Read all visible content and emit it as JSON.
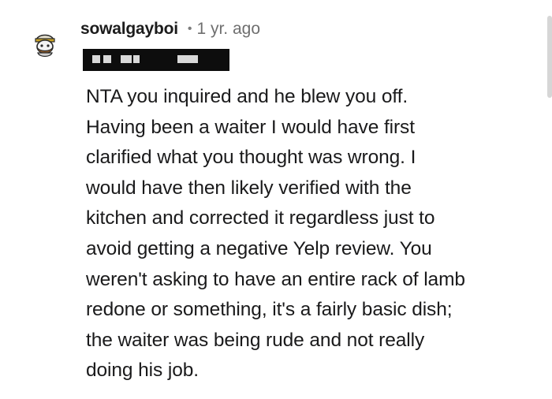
{
  "comment": {
    "username": "sowalgayboi",
    "separator": "•",
    "age": "1 yr. ago",
    "avatar_icon": "snoo-avatar-icon",
    "body": "NTA you inquired and he blew you off.\nHaving been a waiter I would have first\nclarified what you thought was wrong. I\nwould have then likely verified with the\nkitchen and corrected it regardless just to\navoid getting a negative Yelp review. You\nweren't asking to have an entire rack of lamb\nredone or something, it's a fairly basic dish;\nthe waiter was being rude and not really\ndoing his job."
  },
  "colors": {
    "username": "#1c1c1c",
    "meta": "#6f6f6f",
    "body_text": "#1a1a1b",
    "redaction": "#0d0d0d",
    "background": "#ffffff"
  }
}
